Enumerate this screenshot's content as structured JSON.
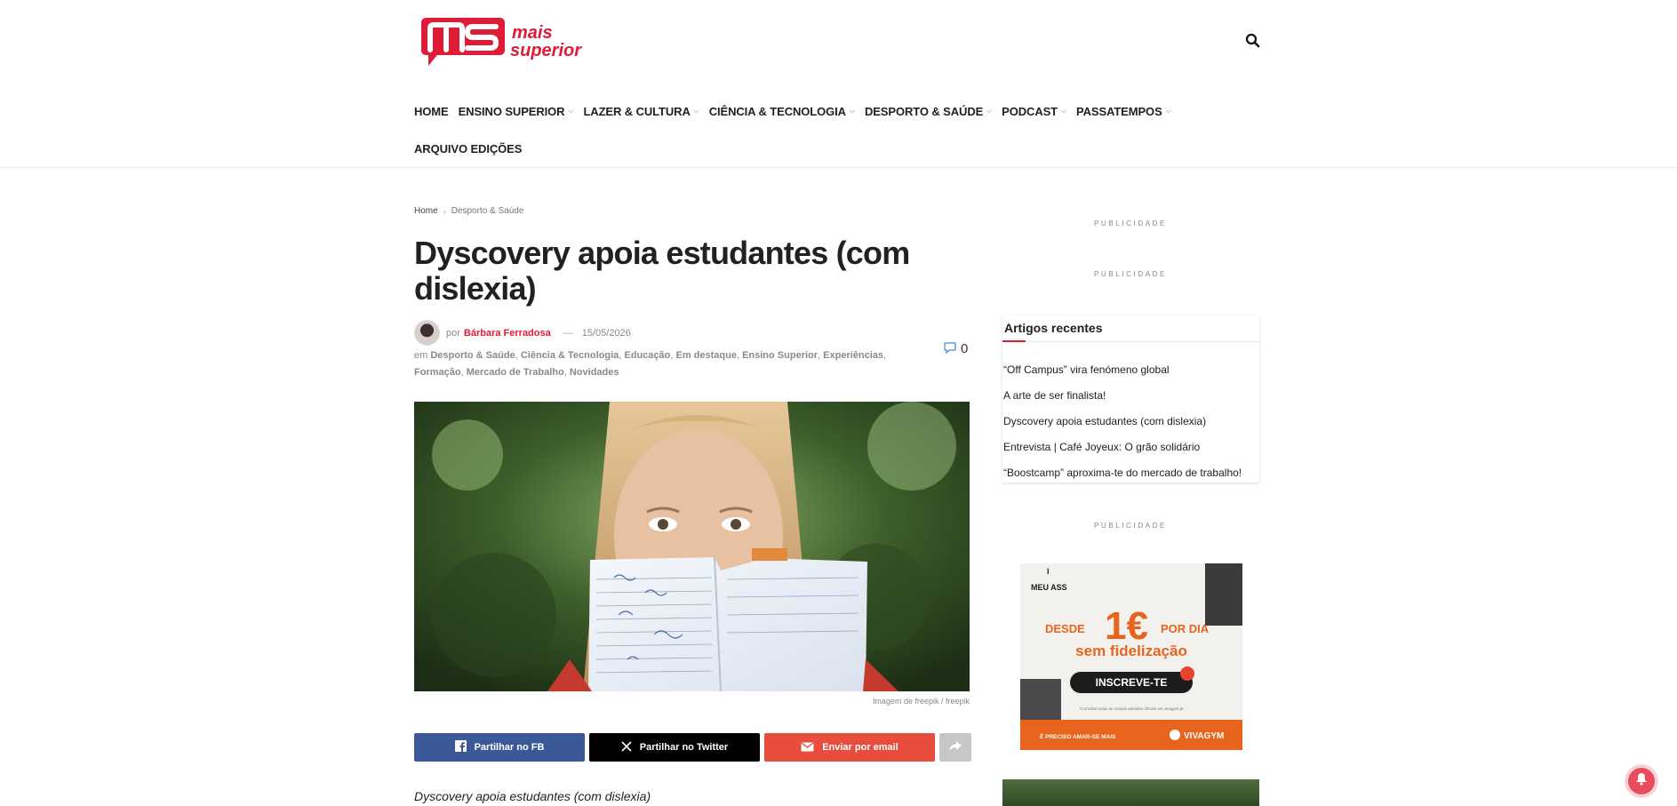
{
  "brand": {
    "logo_top": "mais",
    "logo_bottom": "superior",
    "accent": "#e01b38"
  },
  "nav": {
    "row1": [
      {
        "label": "HOME",
        "dropdown": false
      },
      {
        "label": "ENSINO SUPERIOR",
        "dropdown": true
      },
      {
        "label": "LAZER & CULTURA",
        "dropdown": true
      },
      {
        "label": "CIÊNCIA & TECNOLOGIA",
        "dropdown": true
      },
      {
        "label": "DESPORTO & SAÚDE",
        "dropdown": true
      },
      {
        "label": "PODCAST",
        "dropdown": true
      },
      {
        "label": "PASSATEMPOS",
        "dropdown": true
      }
    ],
    "row2": [
      {
        "label": "ARQUIVO EDIÇÕES",
        "dropdown": false
      }
    ]
  },
  "breadcrumb": {
    "home": "Home",
    "current": "Desporto & Saúde"
  },
  "article": {
    "title": "Dyscovery apoia estudantes (com dislexia)",
    "by": "por",
    "author": "Bárbara Ferradosa",
    "date": "15/05/2026",
    "in": "em",
    "categories": [
      "Desporto & Saúde",
      "Ciência & Tecnologia",
      "Educação",
      "Em destaque",
      "Ensino Superior",
      "Experiências",
      "Formação",
      "Mercado de Trabalho",
      "Novidades"
    ],
    "comments": "0",
    "image_caption": "Imagem de freepik / freepik",
    "intro": "Dyscovery apoia estudantes (com dislexia)"
  },
  "share": {
    "fb": "Partilhar no FB",
    "twitter": "Partilhar no Twitter",
    "email": "Enviar por email"
  },
  "sidebar": {
    "ad_label": "PUBLICIDADE",
    "recent_title": "Artigos recentes",
    "recent": [
      "“Off Campus” vira fenómeno global",
      "A arte de ser finalista!",
      "Dyscovery apoia estudantes (com dislexia)",
      "Entrevista | Café Joyeux: O grão solidário",
      "“Boostcamp” aproxima-te do mercado de trabalho!"
    ],
    "promo": {
      "tag_i": "I",
      "tag_line": "MEU ASS",
      "desde": "DESDE",
      "price": "1€",
      "por_dia": "POR DIA",
      "headline": "sem fidelização",
      "cta": "INSCREVE-TE",
      "small_print": "*Consulta todas as nossas adesões oficiais em vivagym.pt",
      "footer_left": "É PRECISO AMAR-SE MAIS",
      "brand": "VIVAGYM",
      "orange": "#e8641c"
    }
  }
}
